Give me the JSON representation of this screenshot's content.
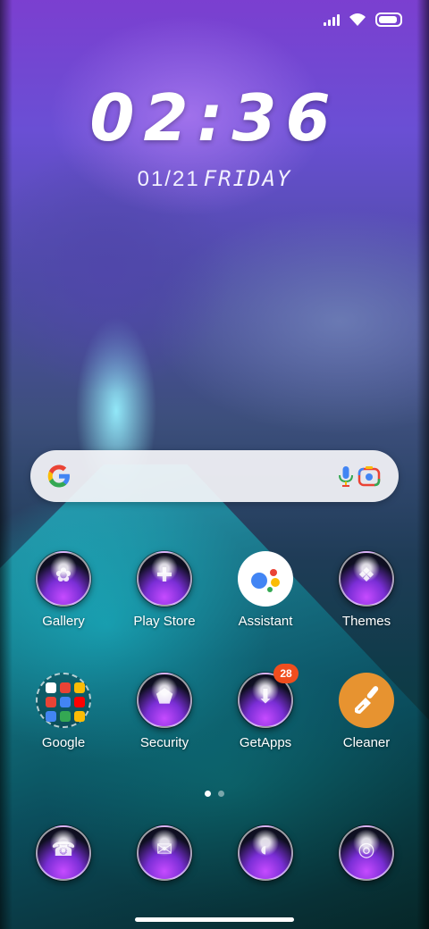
{
  "status_bar": {
    "icons": [
      "signal-icon",
      "wifi-icon",
      "battery-icon"
    ]
  },
  "lock_widget": {
    "time": "02:36",
    "date": "01/21",
    "day": "FRIDAY"
  },
  "search_bar": {
    "icons": [
      "google-g-icon",
      "microphone-icon",
      "lens-camera-icon"
    ]
  },
  "apps": {
    "row1": [
      {
        "label": "Gallery",
        "icon": "gallery-icon"
      },
      {
        "label": "Play Store",
        "icon": "play-store-icon"
      },
      {
        "label": "Assistant",
        "icon": "assistant-icon"
      },
      {
        "label": "Themes",
        "icon": "themes-icon"
      }
    ],
    "row2": [
      {
        "label": "Google",
        "icon": "google-folder-icon"
      },
      {
        "label": "Security",
        "icon": "security-icon"
      },
      {
        "label": "GetApps",
        "icon": "getapps-icon",
        "badge": "28"
      },
      {
        "label": "Cleaner",
        "icon": "cleaner-icon"
      }
    ],
    "dock": [
      {
        "icon": "phone-icon"
      },
      {
        "icon": "messages-icon"
      },
      {
        "icon": "browser-icon"
      },
      {
        "icon": "camera-icon"
      }
    ]
  },
  "page_indicator": {
    "pages": 2,
    "active": 1
  },
  "colors": {
    "search_bg": "#f5f5f8",
    "badge": "#f04e1e",
    "cleaner": "#e79330",
    "assistant_bg": "#ffffff"
  }
}
